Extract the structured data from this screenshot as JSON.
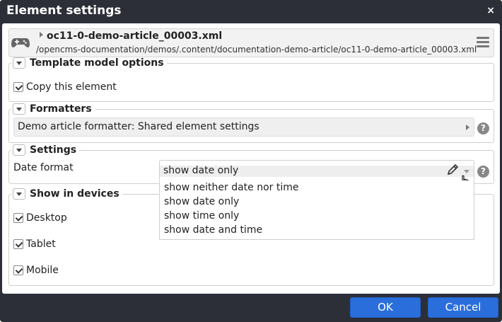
{
  "dialog": {
    "title": "Element settings",
    "close_glyph": "×"
  },
  "resource": {
    "icon": "gamepad-icon",
    "title": "oc11-0-demo-article_00003.xml",
    "path": "/opencms-documentation/demos/.content/documentation-demo-article/oc11-0-demo-article_00003.xml"
  },
  "template_model": {
    "legend": "Template model options",
    "copy_label": "Copy this element",
    "copy_checked": true
  },
  "formatters": {
    "legend": "Formatters",
    "selected": "Demo article formatter: Shared element settings"
  },
  "settings": {
    "legend": "Settings",
    "date_format_label": "Date format",
    "date_format_value": "show date only",
    "options": [
      "show neither date nor time",
      "show date only",
      "show time only",
      "show date and time"
    ]
  },
  "devices": {
    "legend": "Show in devices",
    "items": [
      {
        "label": "Desktop",
        "checked": true
      },
      {
        "label": "Tablet",
        "checked": true
      },
      {
        "label": "Mobile",
        "checked": true
      }
    ]
  },
  "help_glyph": "?",
  "buttons": {
    "ok": "OK",
    "cancel": "Cancel"
  },
  "colors": {
    "title_bar": "#2c2f37",
    "primary_button": "#2a6edb"
  }
}
